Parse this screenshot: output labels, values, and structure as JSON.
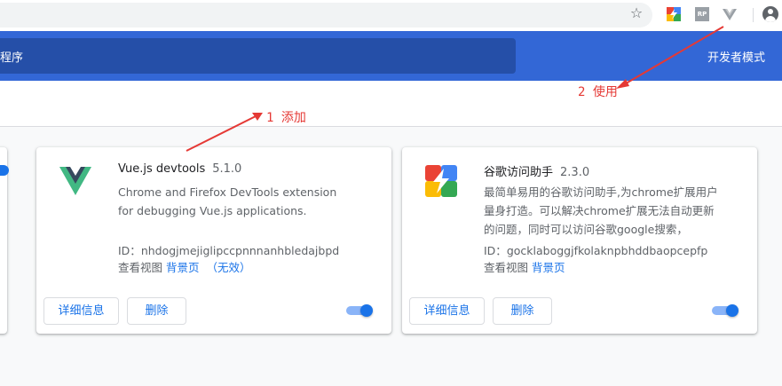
{
  "browser": {
    "star_icon": "☆",
    "extensions": [
      "google-access-helper-icon",
      "rp-extension-icon",
      "vue-devtools-icon"
    ],
    "rp_label": "RP"
  },
  "header": {
    "search_text": "程序",
    "dev_mode_label": "开发者模式",
    "color": "#3367d6"
  },
  "annotations": {
    "add": "1 添加",
    "use": "2 使用",
    "color": "#e53935"
  },
  "cards": [
    {
      "name": "Vue.js devtools",
      "version": "5.1.0",
      "description": "Chrome and Firefox DevTools extension for debugging Vue.js applications.",
      "id_label": "ID：",
      "id": "nhdogjmejiglipccpnnnanhbledajbpd",
      "views_label": "查看视图",
      "background_link": "背景页",
      "inactive_label": "（无效）",
      "details_button": "详细信息",
      "remove_button": "删除",
      "enabled": true
    },
    {
      "name": "谷歌访问助手",
      "version": "2.3.0",
      "description": "最简单易用的谷歌访问助手,为chrome扩展用户量身打造。可以解决chrome扩展无法自动更新的问题，同时可以访问谷歌google搜索，gmail邮箱，谷歌学术等",
      "id_label": "ID：",
      "id": "gocklaboggjfkolaknpbhddbaopcepfp",
      "views_label": "查看视图",
      "background_link": "背景页",
      "details_button": "详细信息",
      "remove_button": "删除",
      "enabled": true
    }
  ]
}
